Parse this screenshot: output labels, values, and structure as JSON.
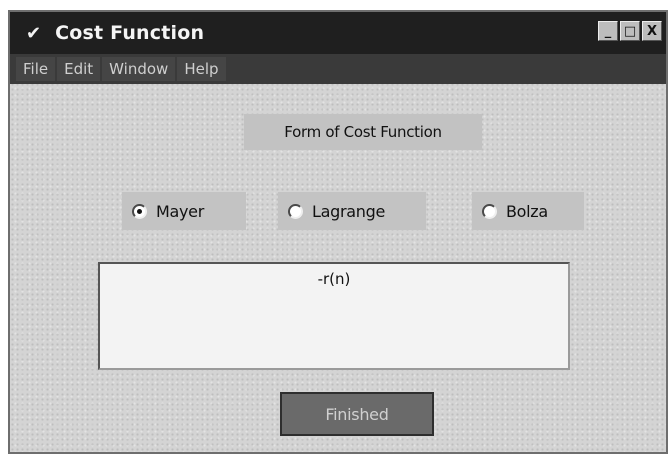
{
  "window": {
    "title": "Cost Function",
    "title_icon": "checkmark-icon",
    "controls": {
      "minimize_glyph": "_",
      "maximize_glyph": "□",
      "close_glyph": "X"
    }
  },
  "menubar": {
    "items": [
      "File",
      "Edit",
      "Window",
      "Help"
    ]
  },
  "main": {
    "form_label": "Form of Cost Function",
    "radio_options": [
      {
        "label": "Mayer",
        "selected": true
      },
      {
        "label": "Lagrange",
        "selected": false
      },
      {
        "label": "Bolza",
        "selected": false
      }
    ],
    "expression": "-r(n)",
    "finished_label": "Finished"
  }
}
